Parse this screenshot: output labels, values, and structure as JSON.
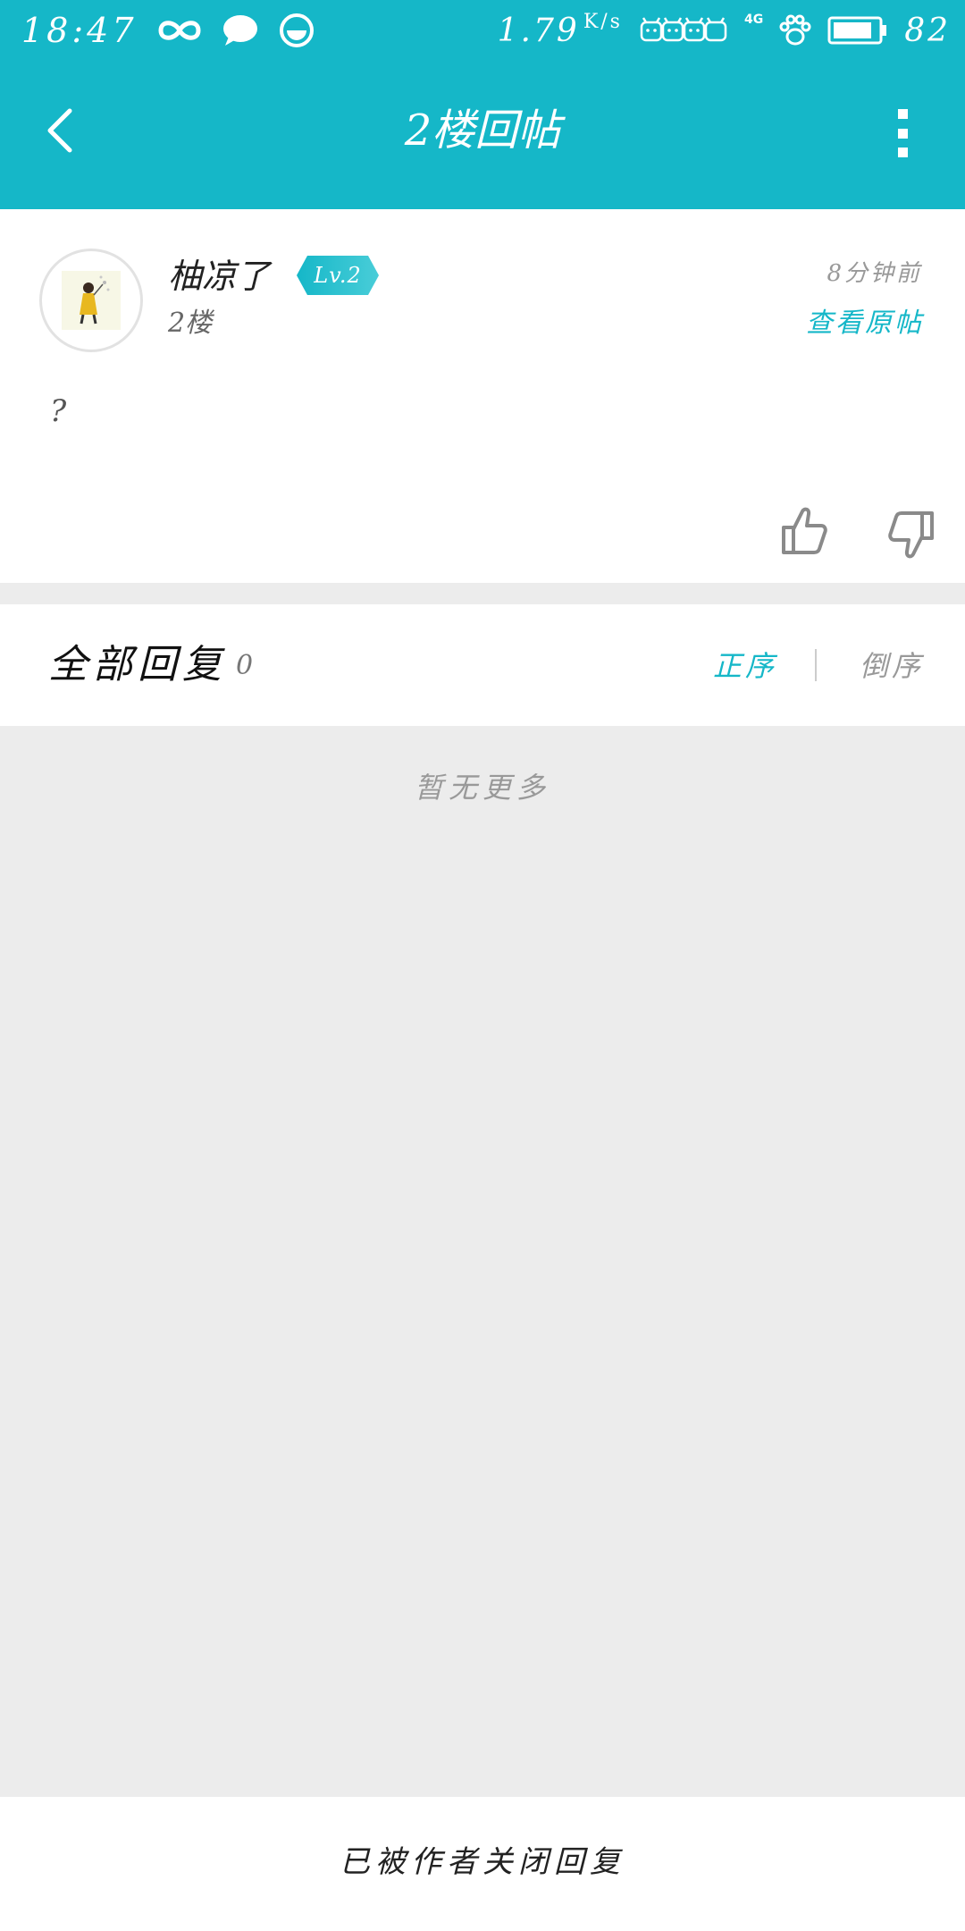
{
  "status_bar": {
    "time": "18:47",
    "net_speed": "1.79",
    "net_speed_unit": "K/s",
    "network_type": "4G",
    "battery": "82",
    "icons": [
      "infinity-icon",
      "chat-bubble-icon",
      "circle-app-icon",
      "bilibili-icon",
      "paw-icon",
      "battery-icon"
    ]
  },
  "header": {
    "title": "2楼回帖",
    "back_icon": "chevron-left-icon",
    "more_icon": "more-vertical-icon",
    "accent_color": "#15b7c8"
  },
  "post": {
    "username": "柚凉了",
    "level": "Lv.2",
    "floor": "2楼",
    "time": "8分钟前",
    "view_original": "查看原帖",
    "content": "?"
  },
  "replies": {
    "title": "全部回复",
    "count": "0",
    "sort_asc": "正序",
    "sort_desc": "倒序",
    "empty_text": "暂无更多"
  },
  "footer": {
    "notice": "已被作者关闭回复"
  }
}
